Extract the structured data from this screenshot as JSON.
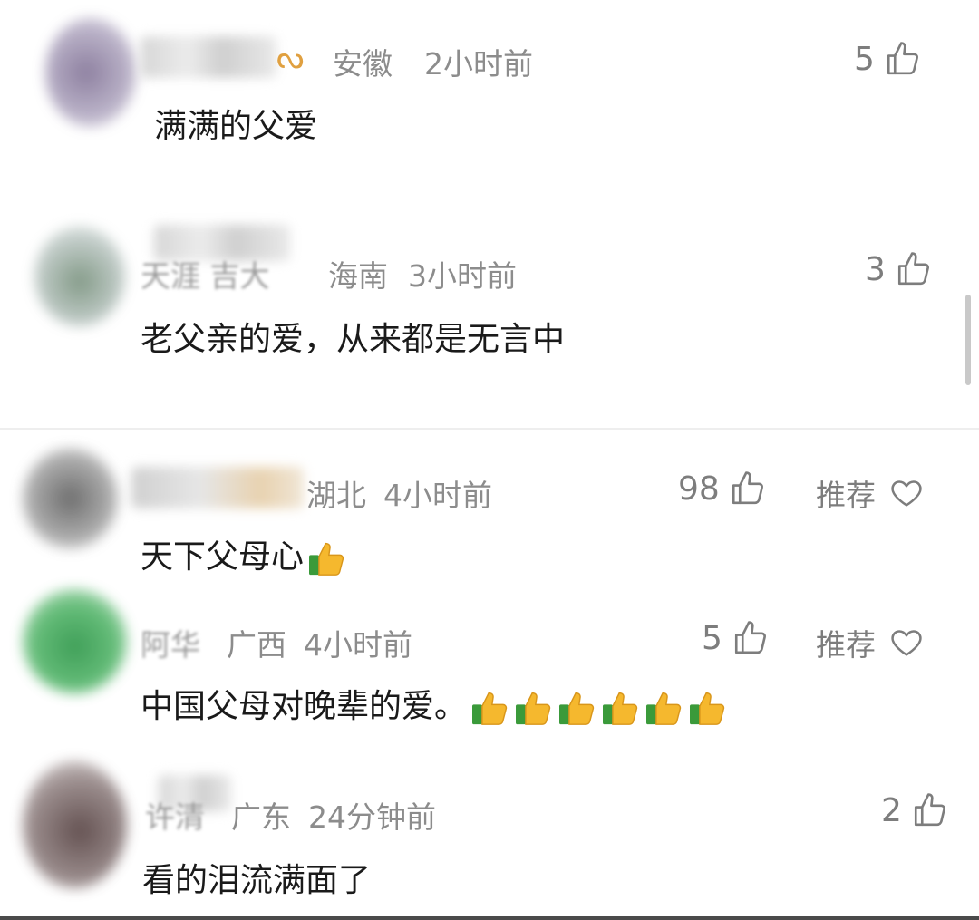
{
  "comments": [
    {
      "name_visible": "",
      "region": "安徽",
      "time": "2小时前",
      "text": "满满的父爱",
      "likes": "5",
      "avatar_color": "#8a7a9a"
    },
    {
      "name_visible": "天涯  吉大",
      "region": "海南",
      "time": "3小时前",
      "text": "老父亲的爱，从来都是无言中",
      "likes": "3",
      "avatar_color": "#7a8a80"
    },
    {
      "name_visible": "",
      "region": "湖北",
      "time": "4小时前",
      "text": "天下父母心",
      "likes": "98",
      "recommend": "推荐",
      "avatar_color": "#6a6a6a"
    },
    {
      "name_visible": "阿华",
      "region": "广西",
      "time": "4小时前",
      "text": "中国父母对晚辈的爱。",
      "likes": "5",
      "recommend": "推荐",
      "avatar_color": "#2f9a4a"
    },
    {
      "name_visible": "许清",
      "region": "广东",
      "time": "24分钟前",
      "text": "看的泪流满面了",
      "likes": "2",
      "avatar_color": "#5a4a4a"
    }
  ],
  "colors": {
    "meta": "#8c8c8c",
    "text": "#1a1a1a",
    "icon": "#7d7d7d",
    "thumb_yellow": "#f5b82e",
    "thumb_cuff": "#3a9a3a"
  },
  "icons": {
    "like": "thumbs-up-outline-icon",
    "recommend": "heart-outline-icon",
    "emoji": "thumbs-up-emoji-icon",
    "badge": "infinity-badge-icon"
  }
}
